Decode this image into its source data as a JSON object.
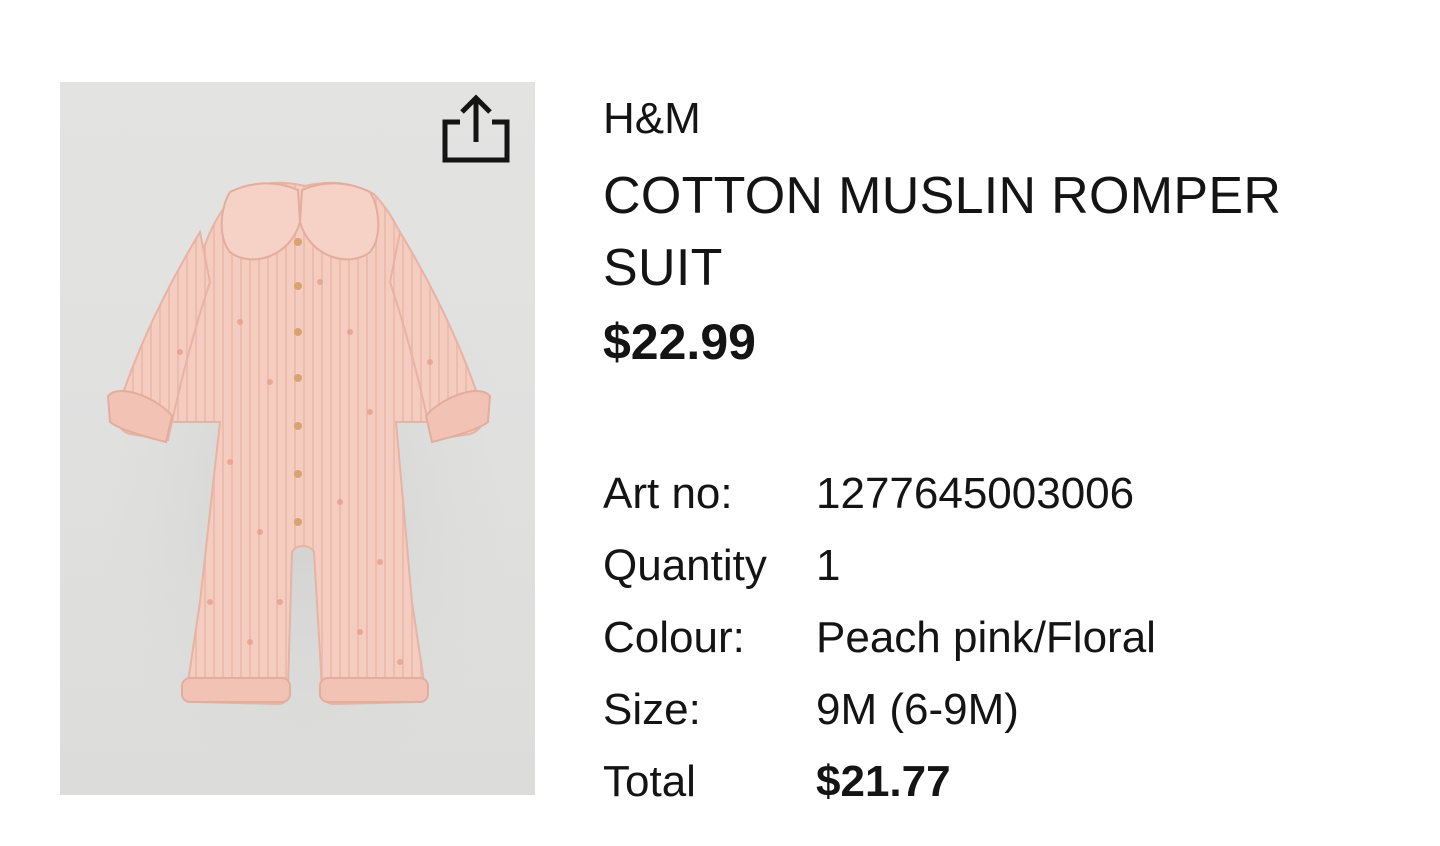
{
  "product": {
    "brand": "H&M",
    "title": "COTTON MUSLIN ROMPER SUIT",
    "price": "$22.99",
    "image_alt_icon": "romper-product-image"
  },
  "actions": {
    "share_icon": "share-icon"
  },
  "details": [
    {
      "label": "Art no:",
      "value": "1277645003006"
    },
    {
      "label": "Quantity",
      "value": "1"
    },
    {
      "label": "Colour:",
      "value": "Peach pink/Floral"
    },
    {
      "label": "Size:",
      "value": "9M (6-9M)"
    },
    {
      "label": "Total",
      "value": "$21.77"
    }
  ],
  "colors": {
    "text": "#141414",
    "image_bg": "#e1e1e0",
    "garment": "#f4c9bc"
  }
}
